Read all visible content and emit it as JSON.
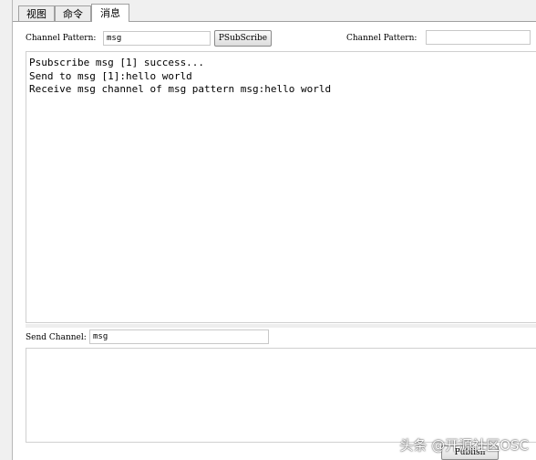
{
  "tabs": [
    {
      "label": "视图",
      "active": false
    },
    {
      "label": "命令",
      "active": false
    },
    {
      "label": "消息",
      "active": true
    }
  ],
  "subscribe": {
    "channel_pattern_label": "Channel Pattern:",
    "channel_pattern_value": "msg",
    "psubscribe_label": "PSubScribe",
    "channel_pattern_label_2": "Channel Pattern:",
    "channel_pattern_value_2": ""
  },
  "output": {
    "lines": [
      "Psubscribe msg [1] success...",
      "Send to msg [1]:hello world",
      "Receive msg channel of msg pattern msg:hello world"
    ]
  },
  "send": {
    "channel_label": "Send Channel:",
    "channel_value": "msg",
    "publish_label": "Publish",
    "message_value": ""
  },
  "watermark": "头条 @开源社区OSC"
}
